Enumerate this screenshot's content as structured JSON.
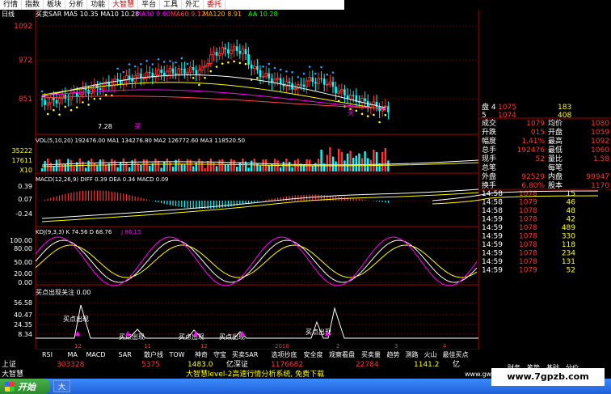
{
  "menu": {
    "items": [
      "行情",
      "指数",
      "板块",
      "分析",
      "功能",
      "大智慧",
      "平台",
      "工具",
      "外汇",
      "委托"
    ],
    "highlight": [
      "大智慧",
      "委托"
    ]
  },
  "price_panel": {
    "period": "日线",
    "ma_header": "买卖SAR MA5 10.35  MA10 10.28",
    "ma30": "MA30 9.60",
    "ma60": "MA60 9.12",
    "ma120": "MA120 8.91",
    "aa": "AA 10.28",
    "y_labels": [
      "1092",
      "972",
      "851"
    ],
    "low_label": "7.28",
    "marker": "买"
  },
  "volume_panel": {
    "header": "VOL(5,10,20) 192476.00 MA1 134276.80 MA2 126772.60 MA3 118520.50",
    "y_labels": [
      "35222",
      "17611",
      "X10"
    ]
  },
  "macd_panel": {
    "header": "MACD(12,26,9) DIFF 0.39 DEA 0.34 MACD 0.09",
    "y_labels": [
      "0.39",
      "0.07",
      "-0.24"
    ]
  },
  "kdj_panel": {
    "header": "KDJ(9,3,3) K 74.56 D 68.76",
    "j_value": "J 86.15",
    "y_labels": [
      "100.00",
      "80.00",
      "50.00",
      "20.00",
      "0.00"
    ]
  },
  "signal_panel": {
    "header": "买点出现关注  0.00",
    "y_labels": [
      "56.58",
      "40.47",
      "24.35",
      "8.34"
    ],
    "buy_labels": [
      "买点出现",
      "买点出现",
      "买点出现",
      "买点出现",
      "买点出现"
    ],
    "x_labels": [
      "12",
      "11",
      "12",
      "2010",
      "2",
      "3",
      "4"
    ]
  },
  "indicator_tabs": [
    "RSI",
    "MA",
    "MACD",
    "SAR",
    "散户线",
    "TOW",
    "神奇",
    "守宝",
    "买卖SAR",
    "选项抄底",
    "安全度",
    "观察看盘",
    "买卖量",
    "趋势",
    "测路",
    "火山",
    "最佳买点"
  ],
  "status_bar": {
    "label_sh": "上证",
    "val_sh": "303328",
    "val_sh2": "5375",
    "val_mid": "1483.0",
    "label_sz": "亿深证",
    "val_sz": "1176682",
    "val_sz2": "22784",
    "val_right": "1141.2",
    "label_right": "亿",
    "brand": "大智慧",
    "ticker": "大智慧level-2高速行情分析系统, 免费下载",
    "url_right": "www.gw."
  },
  "quote": {
    "order_rows": [
      {
        "idx": "盘 4",
        "price": "1075",
        "vol": "183"
      },
      {
        "idx": "5",
        "price": "1074",
        "vol": "408"
      }
    ],
    "fields": [
      {
        "l": "成交",
        "v": "1079",
        "l2": "均价",
        "v2": "1080"
      },
      {
        "l": "升跌",
        "v": "015",
        "l2": "开盘",
        "v2": "1059"
      },
      {
        "l": "幅度",
        "v": "1.41%",
        "l2": "最高",
        "v2": "1092"
      },
      {
        "l": "总手",
        "v": "192476",
        "l2": "最低",
        "v2": "1060"
      },
      {
        "l": "现手",
        "v": "52",
        "l2": "量比",
        "v2": "1.58"
      },
      {
        "l": "总笔",
        "v": "",
        "l2": "每笔",
        "v2": ""
      },
      {
        "l": "外盘",
        "v": "92529",
        "l2": "内盘",
        "v2": "99947"
      },
      {
        "l": "换手",
        "v": "6.80%",
        "l2": "股本",
        "v2": "1170"
      }
    ],
    "ticks": [
      {
        "t": "14:58",
        "p": "1078",
        "v": "15"
      },
      {
        "t": "14:58",
        "p": "1079",
        "v": "46"
      },
      {
        "t": "14:58",
        "p": "1078",
        "v": "48"
      },
      {
        "t": "14:59",
        "p": "1078",
        "v": "42"
      },
      {
        "t": "14:59",
        "p": "1078",
        "v": "489"
      },
      {
        "t": "14:59",
        "p": "1078",
        "v": "330"
      },
      {
        "t": "14:59",
        "p": "1078",
        "v": "118"
      },
      {
        "t": "14:59",
        "p": "1078",
        "v": "234"
      },
      {
        "t": "14:59",
        "p": "1078",
        "v": "131"
      },
      {
        "t": "14:59",
        "p": "1079",
        "v": "52"
      }
    ],
    "tabs": [
      "财务",
      "笔势",
      "基础",
      "分价"
    ]
  },
  "taskbar": {
    "start": "开始",
    "apps": [
      "大"
    ],
    "watermark": "www.7gpzb.com"
  },
  "colors": {
    "bg": "#000",
    "up": "#f33",
    "down": "#0ff",
    "grid": "#800",
    "text_yellow": "#ff0",
    "magenta": "#f0f"
  }
}
